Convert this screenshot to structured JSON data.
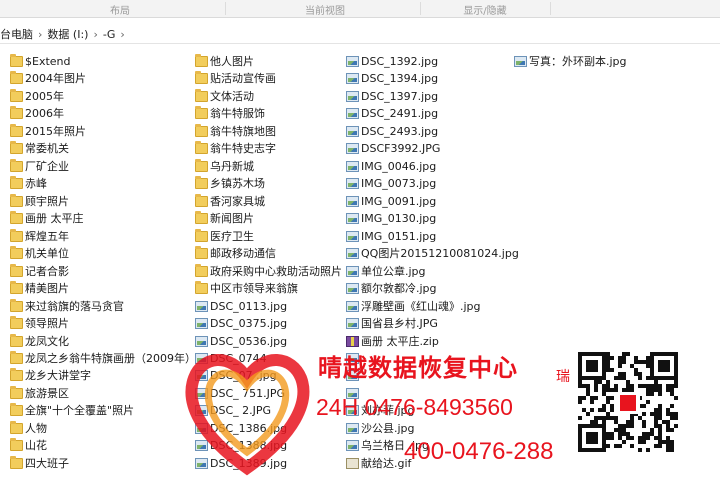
{
  "ribbon": {
    "groups": [
      "布局",
      "当前视图",
      "显示/隐藏"
    ]
  },
  "address": {
    "path": [
      "台电脑",
      "数据 (I:)",
      "-G"
    ],
    "dropdown_glyph": "▾"
  },
  "columns": [
    [
      {
        "name": "$Extend",
        "type": "folder"
      },
      {
        "name": "2004年图片",
        "type": "folder"
      },
      {
        "name": "2005年",
        "type": "folder"
      },
      {
        "name": "2006年",
        "type": "folder"
      },
      {
        "name": "2015年照片",
        "type": "folder"
      },
      {
        "name": "常委机关",
        "type": "folder"
      },
      {
        "name": "厂矿企业",
        "type": "folder"
      },
      {
        "name": "赤峰",
        "type": "folder"
      },
      {
        "name": "顾宇照片",
        "type": "folder"
      },
      {
        "name": "画册 太平庄",
        "type": "folder"
      },
      {
        "name": "辉煌五年",
        "type": "folder"
      },
      {
        "name": "机关单位",
        "type": "folder"
      },
      {
        "name": "记者合影",
        "type": "folder"
      },
      {
        "name": "精美图片",
        "type": "folder"
      },
      {
        "name": "来过翁旗的落马贪官",
        "type": "folder"
      },
      {
        "name": "领导照片",
        "type": "folder"
      },
      {
        "name": "龙凤文化",
        "type": "folder"
      },
      {
        "name": "龙凤之乡翁牛特旗画册（2009年）",
        "type": "folder"
      },
      {
        "name": "龙乡大讲堂字",
        "type": "folder"
      },
      {
        "name": "旅游景区",
        "type": "folder"
      },
      {
        "name": "全旗\"十个全覆盖\"照片",
        "type": "folder"
      },
      {
        "name": "人物",
        "type": "folder"
      },
      {
        "name": "山花",
        "type": "folder"
      },
      {
        "name": "四大班子",
        "type": "folder"
      }
    ],
    [
      {
        "name": "他人图片",
        "type": "folder"
      },
      {
        "name": "贴活动宣传画",
        "type": "folder"
      },
      {
        "name": "文体活动",
        "type": "folder"
      },
      {
        "name": "翁牛特服饰",
        "type": "folder"
      },
      {
        "name": "翁牛特旗地图",
        "type": "folder"
      },
      {
        "name": "翁牛特史志字",
        "type": "folder"
      },
      {
        "name": "乌丹新城",
        "type": "folder"
      },
      {
        "name": "乡镇苏木场",
        "type": "folder"
      },
      {
        "name": "香河家具城",
        "type": "folder"
      },
      {
        "name": "新闻图片",
        "type": "folder"
      },
      {
        "name": "医疗卫生",
        "type": "folder"
      },
      {
        "name": "邮政移动通信",
        "type": "folder"
      },
      {
        "name": "政府采购中心救助活动照片",
        "type": "folder"
      },
      {
        "name": "中区市领导来翁旗",
        "type": "folder"
      },
      {
        "name": "DSC_0113.jpg",
        "type": "img"
      },
      {
        "name": "DSC_0375.jpg",
        "type": "img"
      },
      {
        "name": "DSC_0536.jpg",
        "type": "img"
      },
      {
        "name": "DSC_0744",
        "type": "img"
      },
      {
        "name": "DSC_07 .jpg",
        "type": "img"
      },
      {
        "name": "DSC_ 751.JPG",
        "type": "img"
      },
      {
        "name": "DSC_ 2.JPG",
        "type": "img"
      },
      {
        "name": "DSC_1386.jpg",
        "type": "img"
      },
      {
        "name": "DSC_1388.jpg",
        "type": "img"
      },
      {
        "name": "DSC_1389.jpg",
        "type": "img"
      }
    ],
    [
      {
        "name": "DSC_1392.jpg",
        "type": "img"
      },
      {
        "name": "DSC_1394.jpg",
        "type": "img"
      },
      {
        "name": "DSC_1397.jpg",
        "type": "img"
      },
      {
        "name": "DSC_2491.jpg",
        "type": "img"
      },
      {
        "name": "DSC_2493.jpg",
        "type": "img"
      },
      {
        "name": "DSCF3992.JPG",
        "type": "img"
      },
      {
        "name": "IMG_0046.jpg",
        "type": "img"
      },
      {
        "name": "IMG_0073.jpg",
        "type": "img"
      },
      {
        "name": "IMG_0091.jpg",
        "type": "img"
      },
      {
        "name": "IMG_0130.jpg",
        "type": "img"
      },
      {
        "name": "IMG_0151.jpg",
        "type": "img"
      },
      {
        "name": "QQ图片20151210081024.jpg",
        "type": "img"
      },
      {
        "name": "单位公章.jpg",
        "type": "img"
      },
      {
        "name": "额尔敦都冷.jpg",
        "type": "img"
      },
      {
        "name": "浮雕壁画《红山魂》.jpg",
        "type": "img"
      },
      {
        "name": "国省县乡村.JPG",
        "type": "img"
      },
      {
        "name": "画册 太平庄.zip",
        "type": "zip"
      },
      {
        "name": "",
        "type": "img"
      },
      {
        "name": "",
        "type": "img"
      },
      {
        "name": "",
        "type": "img"
      },
      {
        "name": "刘亦菲.jpg",
        "type": "img"
      },
      {
        "name": "沙公县.jpg",
        "type": "img"
      },
      {
        "name": "乌兰格日 .jpg",
        "type": "img"
      },
      {
        "name": "献给达.gif",
        "type": "gif"
      }
    ],
    [
      {
        "name": "写真：外环副本.jpg",
        "type": "img"
      }
    ]
  ],
  "watermark": {
    "title": "晴越数据恢复中心",
    "phone1": "24H 0476-8493560",
    "phone2": "400-0476-288",
    "seal": "瑞",
    "colors": {
      "red": "#e8141e",
      "orange": "#f39a1e"
    }
  }
}
